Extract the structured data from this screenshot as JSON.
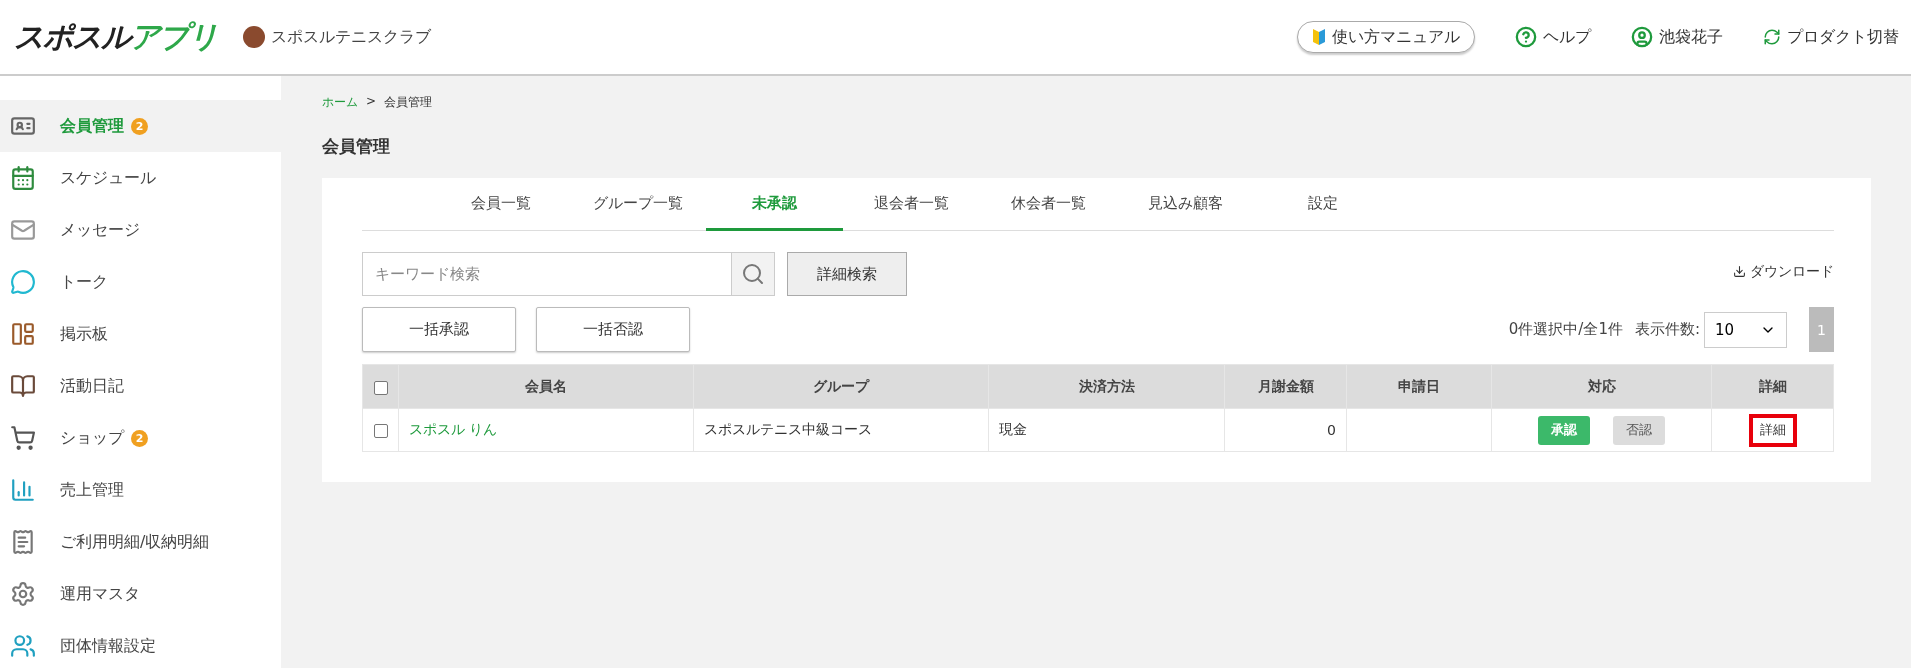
{
  "header": {
    "logo": "スポスルアプリ",
    "club": "スポスルテニスクラブ",
    "manual": "使い方マニュアル",
    "help": "ヘルプ",
    "user": "池袋花子",
    "switch": "プロダクト切替"
  },
  "sidebar": {
    "items": [
      {
        "label": "会員管理",
        "badge": "2",
        "selected": true
      },
      {
        "label": "スケジュール",
        "selected": false
      },
      {
        "label": "メッセージ",
        "selected": false
      },
      {
        "label": "トーク",
        "selected": false
      },
      {
        "label": "掲示板",
        "selected": false
      },
      {
        "label": "活動日記",
        "selected": false
      },
      {
        "label": "ショップ",
        "badge": "2",
        "selected": false
      },
      {
        "label": "売上管理",
        "selected": false
      },
      {
        "label": "ご利用明細/収納明細",
        "selected": false
      },
      {
        "label": "運用マスタ",
        "selected": false
      },
      {
        "label": "団体情報設定",
        "selected": false
      }
    ]
  },
  "breadcrumb": {
    "home": "ホーム",
    "separator": ">",
    "current": "会員管理"
  },
  "page_title": "会員管理",
  "tabs": [
    {
      "label": "会員一覧",
      "selected": false
    },
    {
      "label": "グループ一覧",
      "selected": false
    },
    {
      "label": "未承認",
      "selected": true
    },
    {
      "label": "退会者一覧",
      "selected": false
    },
    {
      "label": "休会者一覧",
      "selected": false
    },
    {
      "label": "見込み顧客",
      "selected": false
    },
    {
      "label": "設定",
      "selected": false
    }
  ],
  "search": {
    "placeholder": "キーワード検索",
    "advanced": "詳細検索"
  },
  "download": "ダウンロード",
  "bulk_buttons": [
    "一括承認",
    "一括否認"
  ],
  "selection_count": "0件選択中/全1件",
  "page_size": {
    "label": "表示件数:",
    "value": "10"
  },
  "pagination": [
    {
      "label": "1",
      "selected": true
    }
  ],
  "table": {
    "select_all_checked": false,
    "columns": [
      "会員名",
      "グループ",
      "決済方法",
      "月謝金額",
      "申請日",
      "対応",
      "詳細"
    ],
    "rows": [
      {
        "checked": false,
        "name": "スポスル りん",
        "group": "スポスルテニス中級コース",
        "payment": "現金",
        "monthly_fee": "0",
        "approve": "承認",
        "reject": "否認",
        "detail": "詳細",
        "detail_highlighted": true
      }
    ]
  }
}
